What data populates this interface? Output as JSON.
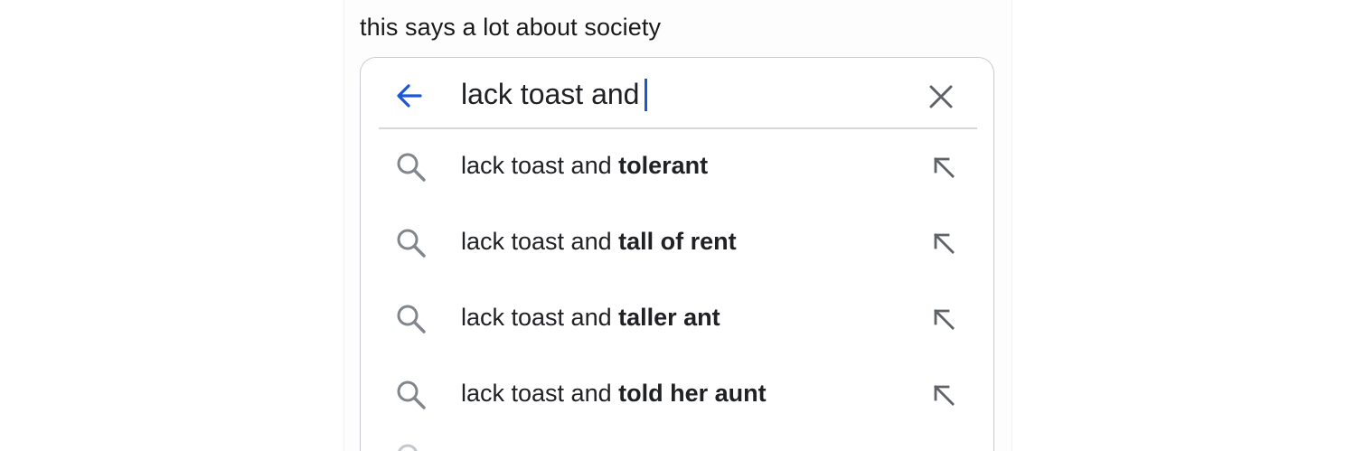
{
  "caption": "this says a lot about society",
  "search": {
    "query": "lack toast and",
    "icons": {
      "back": "arrow-left-icon",
      "clear": "close-icon"
    },
    "colors": {
      "accent": "#1a56d6",
      "icon_gray": "#70757a",
      "text": "#202124"
    }
  },
  "suggestions": [
    {
      "prefix": "lack toast and ",
      "completion": "tolerant"
    },
    {
      "prefix": "lack toast and ",
      "completion": "tall of rent"
    },
    {
      "prefix": "lack toast and ",
      "completion": "taller ant"
    },
    {
      "prefix": "lack toast and ",
      "completion": "told her aunt"
    }
  ]
}
